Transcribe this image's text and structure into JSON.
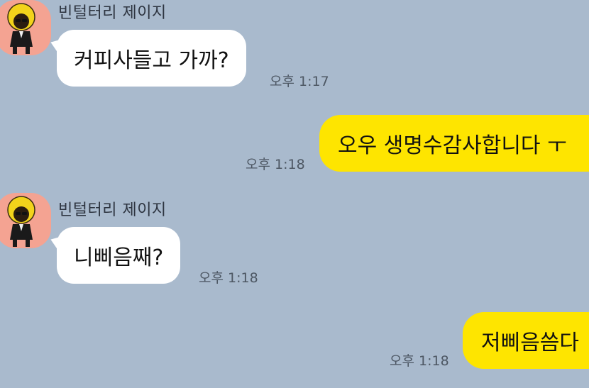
{
  "messages": [
    {
      "kind": "received",
      "sender": "빈털터리 제이지",
      "text": "커피사들고 가까?",
      "time": "오후 1:17",
      "avatar_icon": "afro-character-avatar"
    },
    {
      "kind": "sent",
      "text": "오우 생명수감사합니다 ㅜ",
      "time": "오후 1:18"
    },
    {
      "kind": "received",
      "sender": "빈털터리 제이지",
      "text": "니삐음째?",
      "time": "오후 1:18",
      "avatar_icon": "afro-character-avatar"
    },
    {
      "kind": "sent",
      "text": "저삐음씀다",
      "time": "오후 1:18"
    }
  ],
  "colors": {
    "background": "#a9bacd",
    "sent_bubble": "#fee500",
    "received_bubble": "#ffffff",
    "avatar_bg": "#f4a392"
  }
}
